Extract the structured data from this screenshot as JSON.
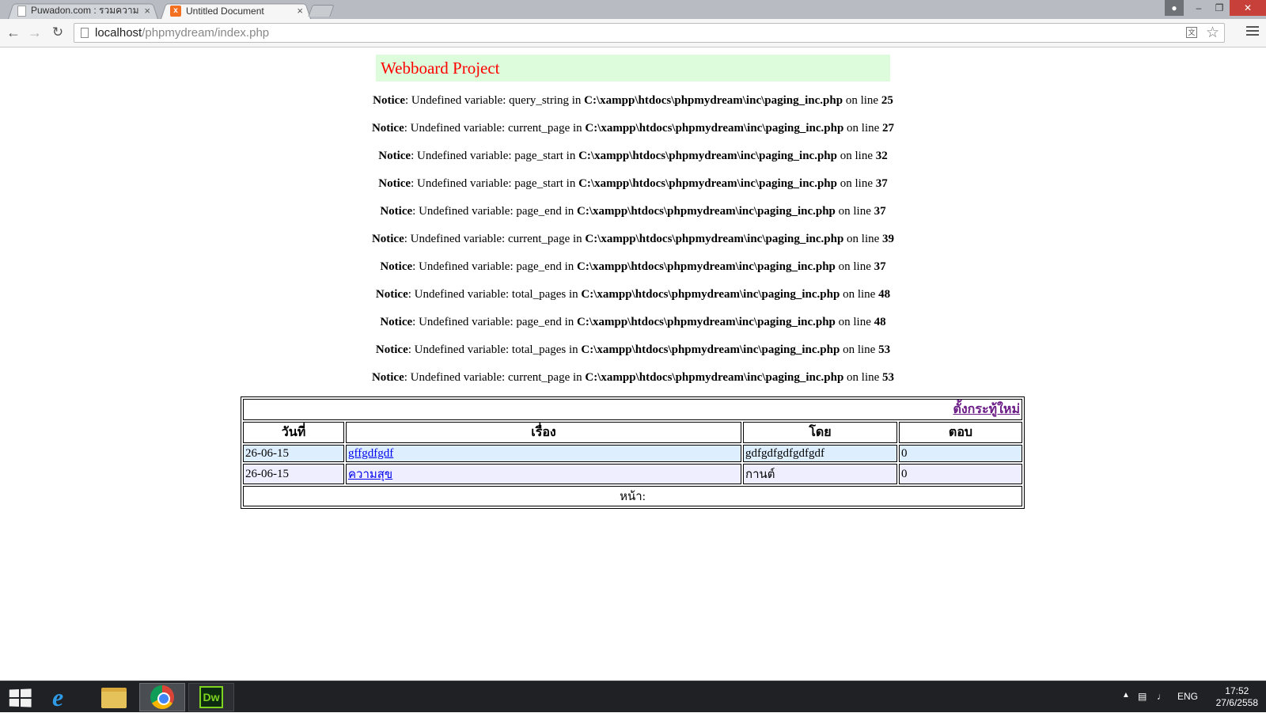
{
  "browser": {
    "tabs": [
      {
        "title": "Puwadon.com : รวมความรู้...",
        "active": false,
        "close": "×"
      },
      {
        "title": "Untitled Document",
        "active": true,
        "close": "×"
      }
    ],
    "url_host": "localhost",
    "url_path": "/phpmydream/index.php"
  },
  "page": {
    "header": "Webboard Project",
    "notices": [
      {
        "label": "Notice",
        "msg": ": Undefined variable: query_string in ",
        "file": "C:\\xampp\\htdocs\\phpmydream\\inc\\paging_inc.php",
        "online": " on line ",
        "line": "25"
      },
      {
        "label": "Notice",
        "msg": ": Undefined variable: current_page in ",
        "file": "C:\\xampp\\htdocs\\phpmydream\\inc\\paging_inc.php",
        "online": " on line ",
        "line": "27"
      },
      {
        "label": "Notice",
        "msg": ": Undefined variable: page_start in ",
        "file": "C:\\xampp\\htdocs\\phpmydream\\inc\\paging_inc.php",
        "online": " on line ",
        "line": "32"
      },
      {
        "label": "Notice",
        "msg": ": Undefined variable: page_start in ",
        "file": "C:\\xampp\\htdocs\\phpmydream\\inc\\paging_inc.php",
        "online": " on line ",
        "line": "37"
      },
      {
        "label": "Notice",
        "msg": ": Undefined variable: page_end in ",
        "file": "C:\\xampp\\htdocs\\phpmydream\\inc\\paging_inc.php",
        "online": " on line ",
        "line": "37"
      },
      {
        "label": "Notice",
        "msg": ": Undefined variable: current_page in ",
        "file": "C:\\xampp\\htdocs\\phpmydream\\inc\\paging_inc.php",
        "online": " on line ",
        "line": "39"
      },
      {
        "label": "Notice",
        "msg": ": Undefined variable: page_end in ",
        "file": "C:\\xampp\\htdocs\\phpmydream\\inc\\paging_inc.php",
        "online": " on line ",
        "line": "37"
      },
      {
        "label": "Notice",
        "msg": ": Undefined variable: total_pages in ",
        "file": "C:\\xampp\\htdocs\\phpmydream\\inc\\paging_inc.php",
        "online": " on line ",
        "line": "48"
      },
      {
        "label": "Notice",
        "msg": ": Undefined variable: page_end in ",
        "file": "C:\\xampp\\htdocs\\phpmydream\\inc\\paging_inc.php",
        "online": " on line ",
        "line": "48"
      },
      {
        "label": "Notice",
        "msg": ": Undefined variable: total_pages in ",
        "file": "C:\\xampp\\htdocs\\phpmydream\\inc\\paging_inc.php",
        "online": " on line ",
        "line": "53"
      },
      {
        "label": "Notice",
        "msg": ": Undefined variable: current_page in ",
        "file": "C:\\xampp\\htdocs\\phpmydream\\inc\\paging_inc.php",
        "online": " on line ",
        "line": "53"
      }
    ],
    "board": {
      "new_topic": "ตั้งกระทู้ใหม่",
      "columns": [
        "วันที่",
        "เรื่อง",
        "โดย",
        "ตอบ"
      ],
      "rows": [
        {
          "date": "26-06-15",
          "topic": "gffgdfgdf",
          "by": "gdfgdfgdfgdfgdf",
          "replies": "0"
        },
        {
          "date": "26-06-15",
          "topic": "ความสุข",
          "by": "กานต์",
          "replies": "0"
        }
      ],
      "pager": "หน้า:"
    }
  },
  "taskbar": {
    "dw_label": "Dw",
    "lang": "ENG",
    "time": "17:52",
    "date": "27/6/2558"
  }
}
